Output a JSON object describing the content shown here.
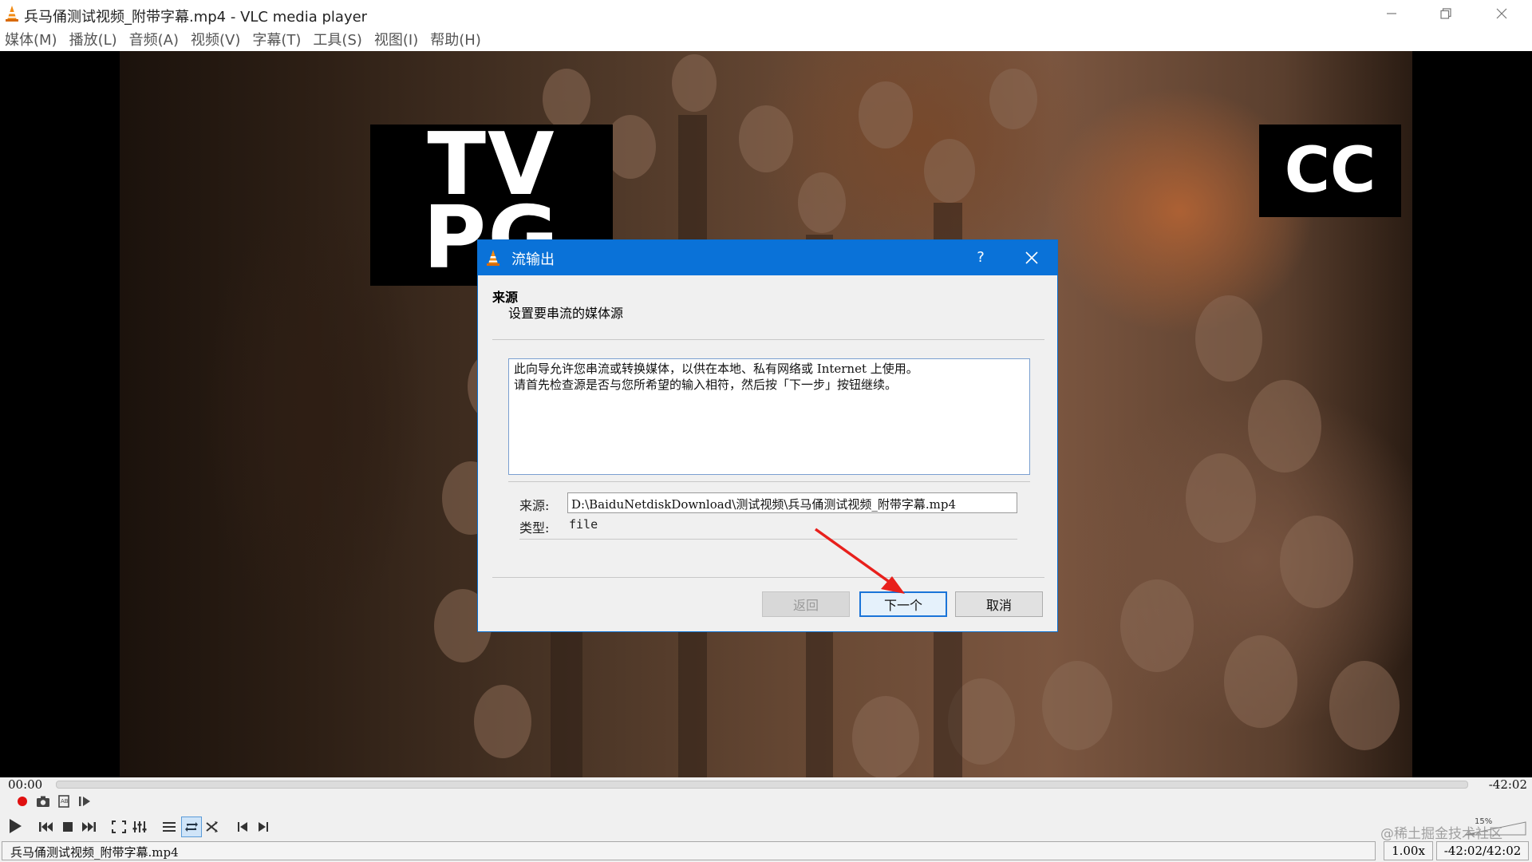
{
  "window": {
    "title": "兵马俑测试视频_附带字幕.mp4 - VLC media player"
  },
  "menu": [
    {
      "label": "媒体(M)"
    },
    {
      "label": "播放(L)"
    },
    {
      "label": "音频(A)"
    },
    {
      "label": "视频(V)"
    },
    {
      "label": "字幕(T)"
    },
    {
      "label": "工具(S)"
    },
    {
      "label": "视图(I)"
    },
    {
      "label": "帮助(H)"
    }
  ],
  "video": {
    "badge_tv_line1": "TV",
    "badge_tv_line2": "PG",
    "badge_cc": "CC"
  },
  "dialog": {
    "title": "流输出",
    "help": "?",
    "section_title": "来源",
    "section_subtitle": "设置要串流的媒体源",
    "description_line1": "此向导允许您串流或转换媒体，以供在本地、私有网络或 Internet 上使用。",
    "description_line2": "请首先检查源是否与您所希望的输入相符，然后按「下一步」按钮继续。",
    "source_label": "来源:",
    "source_value": "D:\\BaiduNetdiskDownload\\测试视频\\兵马俑测试视频_附带字幕.mp4",
    "type_label": "类型:",
    "type_value": "file",
    "back_label": "返回",
    "next_label": "下一个",
    "cancel_label": "取消"
  },
  "player": {
    "time_elapsed": "00:00",
    "time_remaining": "-42:02",
    "progress": 0.0,
    "file_name": "兵马俑测试视频_附带字幕.mp4",
    "speed": "1.00x",
    "time_display": "-42:02/42:02",
    "volume_label": "15%",
    "watermark": "@稀土掘金技术社区"
  },
  "colors": {
    "dialog_title_bar": "#0a72d8",
    "annotation_arrow": "#e8201c",
    "record_button": "#e01010"
  }
}
